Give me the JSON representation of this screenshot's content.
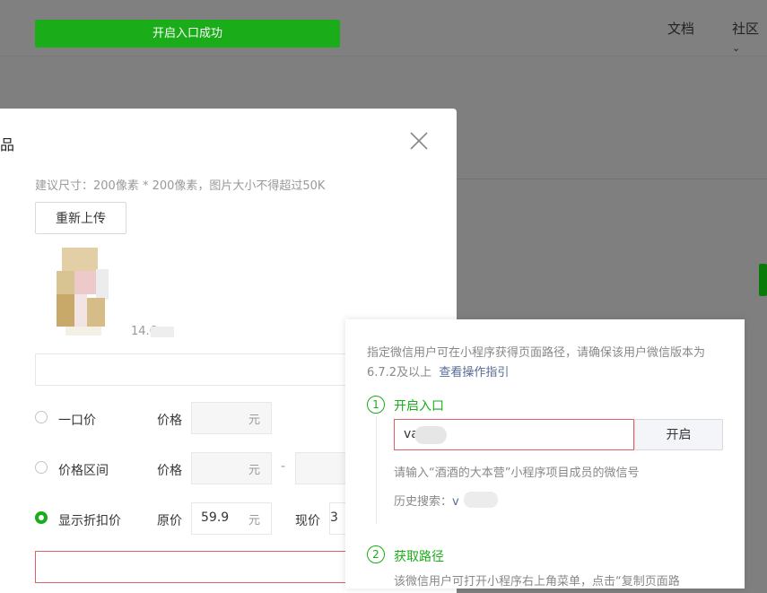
{
  "topbar": {
    "toast": "开启入口成功",
    "links": [
      "文档",
      "社区"
    ]
  },
  "dialog": {
    "title_fragment": "品",
    "image_hint": "建议尺寸：200像素 * 200像素，图片大小不得超过50K",
    "reupload_label": "重新上传",
    "file_size": "14.6",
    "price_options": [
      {
        "label": "一口价",
        "checked": false
      },
      {
        "label": "价格区间",
        "checked": false
      },
      {
        "label": "显示折扣价",
        "checked": true
      }
    ],
    "price_label": "价格",
    "unit": "元",
    "range_dash": "-",
    "original_price_label": "原价",
    "original_price_value": "59.9",
    "current_price_label": "现价",
    "current_price_value": "3"
  },
  "popover": {
    "desc_text": "指定微信用户可在小程序获得页面路径，请确保该用户微信版本为6.7.2及以上",
    "guide_link": "查看操作指引",
    "step1": {
      "num": "1",
      "title": "开启入口"
    },
    "wechat_value": "va",
    "open_button": "开启",
    "tip": "请输入“酒酒的大本营”小程序项目成员的微信号",
    "history_label": "历史搜索：",
    "history_item": "v",
    "step2": {
      "num": "2",
      "title": "获取路径"
    },
    "step2_desc": "该微信用户可打开小程序右上角菜单，点击“复制页面路"
  }
}
